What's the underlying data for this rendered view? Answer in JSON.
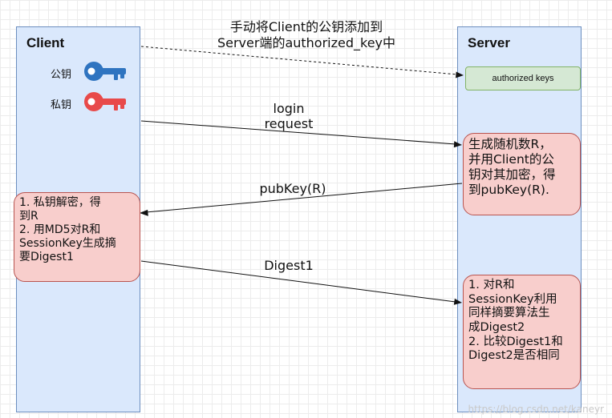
{
  "client": {
    "title": "Client"
  },
  "server": {
    "title": "Server"
  },
  "keys": {
    "public_label": "公钥",
    "private_label": "私钥",
    "public_color": "#2f74c0",
    "private_color": "#e84a4a"
  },
  "authorized_keys": "authorized keys",
  "messages": {
    "copy_key_note": "手动将Client的公钥添加到\nServer端的authorized_key中",
    "login_request": "login\nrequest",
    "pubkey_r": "pubKey(R)",
    "digest1": "Digest1"
  },
  "steps": {
    "server_generate": "生成随机数R，\n并用Client的公\n钥对其加密，得\n到pubKey(R).",
    "client_decrypt": "1. 私钥解密，得\n到R\n2. 用MD5对R和\nSessionKey生成摘\n要Digest1",
    "server_verify": "1. 对R和\nSessionKey利用\n同样摘要算法生\n成Digest2\n2. 比较Digest1和\nDigest2是否相同"
  },
  "colors": {
    "lane_fill": "#dae8fc",
    "lane_border": "#6c8ebf",
    "step_fill": "#f8cecc",
    "step_border": "#b85450",
    "auth_fill": "#d5e8d4",
    "auth_border": "#82b366"
  },
  "watermark": "https://blog.csdn.net/kaneyr"
}
